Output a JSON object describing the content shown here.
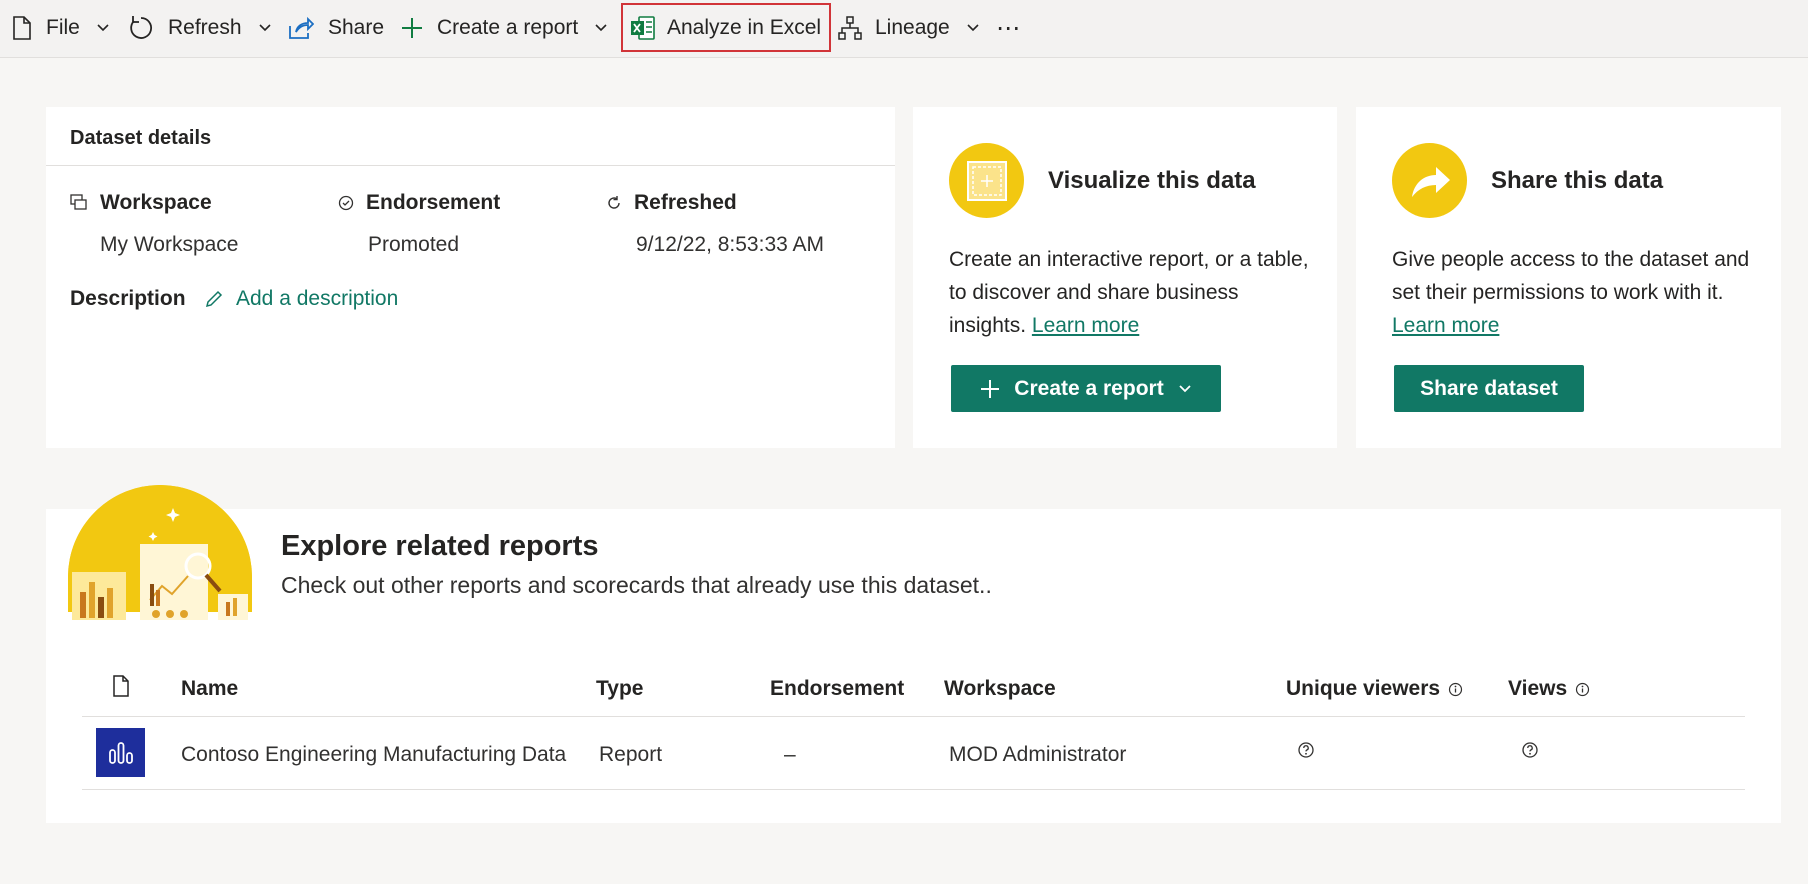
{
  "toolbar": {
    "file": "File",
    "refresh": "Refresh",
    "share": "Share",
    "create_report": "Create a report",
    "analyze_excel": "Analyze in Excel",
    "lineage": "Lineage",
    "more": "⋯"
  },
  "details": {
    "title": "Dataset details",
    "workspace_label": "Workspace",
    "workspace_value": "My Workspace",
    "endorsement_label": "Endorsement",
    "endorsement_value": "Promoted",
    "refreshed_label": "Refreshed",
    "refreshed_value": "9/12/22, 8:53:33 AM",
    "description_label": "Description",
    "add_description": "Add a description"
  },
  "visualize": {
    "title": "Visualize this data",
    "body": "Create an interactive report, or a table, to discover and share business insights.",
    "learn_more": "Learn more",
    "button": "Create a report"
  },
  "share_card": {
    "title": "Share this data",
    "body": "Give people access to the dataset and set their permissions to work with it.",
    "learn_more": "Learn more",
    "button": "Share dataset"
  },
  "explore": {
    "title": "Explore related reports",
    "subtitle": "Check out other reports and scorecards that already use this dataset..",
    "columns": {
      "name": "Name",
      "type": "Type",
      "endorsement": "Endorsement",
      "workspace": "Workspace",
      "unique_viewers": "Unique viewers",
      "views": "Views"
    },
    "rows": [
      {
        "name": "Contoso Engineering Manufacturing Data",
        "type": "Report",
        "endorsement": "–",
        "workspace": "MOD Administrator"
      }
    ]
  },
  "colors": {
    "accent_green": "#117865",
    "yellow": "#f2c811",
    "highlight_red": "#d13438",
    "report_blue": "#1e2e9c"
  }
}
